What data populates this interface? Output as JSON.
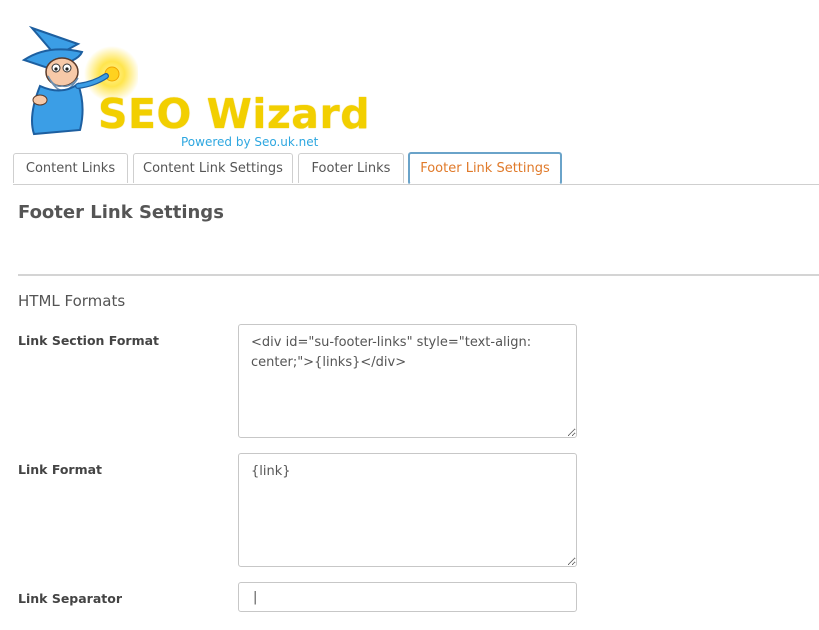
{
  "logo": {
    "title": "SEO Wizard",
    "subtitle": "Powered by Seo.uk.net"
  },
  "tabs": [
    {
      "label": "Content Links",
      "active": false
    },
    {
      "label": "Content Link Settings",
      "active": false
    },
    {
      "label": "Footer Links",
      "active": false
    },
    {
      "label": "Footer Link Settings",
      "active": true
    }
  ],
  "page": {
    "title": "Footer Link Settings",
    "section": "HTML Formats"
  },
  "fields": {
    "link_section_format": {
      "label": "Link Section Format",
      "value": "<div id=\"su-footer-links\" style=\"text-align: center;\">{links}</div>"
    },
    "link_format": {
      "label": "Link Format",
      "value": "{link}"
    },
    "link_separator": {
      "label": "Link Separator",
      "value": "|"
    }
  },
  "colors": {
    "active_tab_text": "#e07a2a",
    "logo_yellow": "#f2cf00",
    "logo_blue": "#2ea7e0"
  }
}
